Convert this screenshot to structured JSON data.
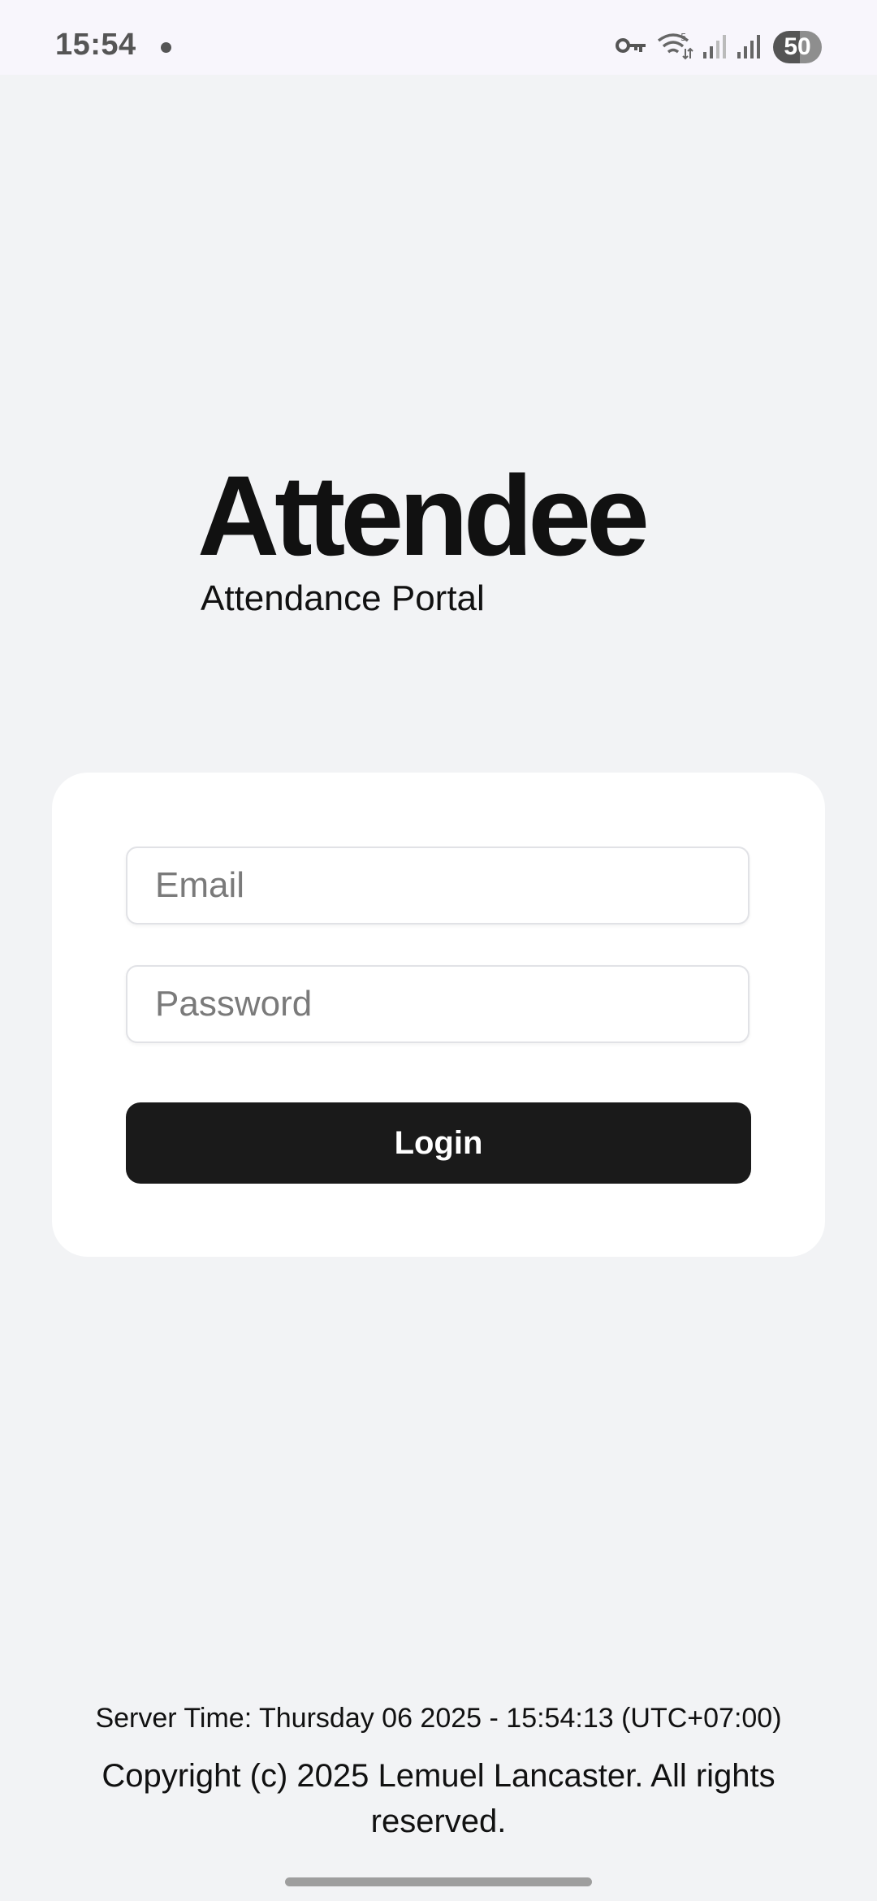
{
  "status_bar": {
    "time": "15:54",
    "battery_level": "50",
    "icons": [
      "vpn-key-icon",
      "wifi-icon",
      "signal-icon",
      "signal-icon"
    ]
  },
  "brand": {
    "title": "Attendee",
    "subtitle": "Attendance Portal"
  },
  "login_form": {
    "email_placeholder": "Email",
    "password_placeholder": "Password",
    "login_label": "Login"
  },
  "footer": {
    "server_time": "Server Time: Thursday 06 2025 - 15:54:13 (UTC+07:00)",
    "copyright": "Copyright (c) 2025 Lemuel Lancaster. All rights reserved."
  },
  "colors": {
    "background": "#f2f3f5",
    "card": "#ffffff",
    "button": "#1a1a1a",
    "text": "#111111"
  }
}
